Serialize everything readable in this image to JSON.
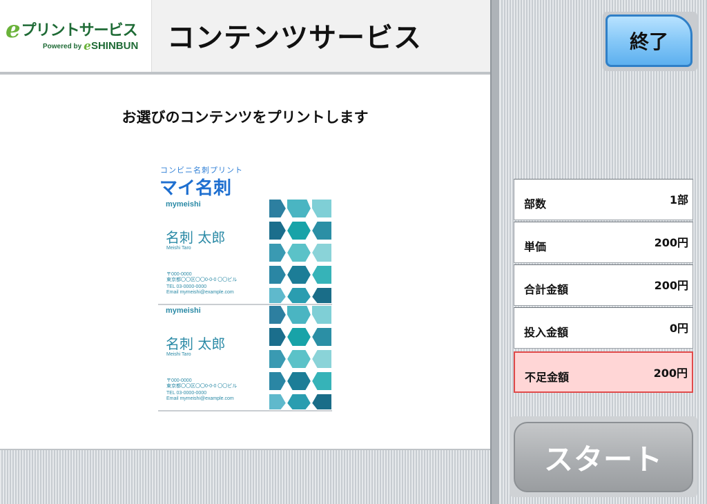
{
  "header": {
    "logo_text": "プリントサービス",
    "logo_powered_by": "Powered by",
    "logo_brand": "SHINBUN",
    "title": "コンテンツサービス"
  },
  "main": {
    "instruction": "お選びのコンテンツをプリントします",
    "preview": {
      "kicker": "コンビニ名刺プリント",
      "title": "マイ名刺",
      "cards": [
        {
          "brand": "mymeishi",
          "name": "名刺 太郎",
          "name_en": "Meishi Taro",
          "postal": "〒000-0000",
          "address": "東京都〇〇区〇〇0-0-0 〇〇ビル",
          "tel": "TEL 03-0000-0000",
          "email": "Email mymeishi@example.com"
        },
        {
          "brand": "mymeishi",
          "name": "名刺 太郎",
          "name_en": "Meishi Taro",
          "postal": "〒000-0000",
          "address": "東京都〇〇区〇〇0-0-0 〇〇ビル",
          "tel": "TEL 03-0000-0000",
          "email": "Email mymeishi@example.com"
        }
      ]
    }
  },
  "sidebar": {
    "end_button": "終了",
    "rows": [
      {
        "label": "部数",
        "value": "1部"
      },
      {
        "label": "単価",
        "value": "200円"
      },
      {
        "label": "合計金額",
        "value": "200円"
      },
      {
        "label": "投入金額",
        "value": "0円"
      },
      {
        "label": "不足金額",
        "value": "200円"
      }
    ],
    "start_button": "スタート"
  },
  "colors": {
    "accent_blue": "#5db0ef",
    "deficit_bg": "#ffd6d6",
    "deficit_border": "#e04a4a",
    "logo_green": "#1f6b36"
  }
}
